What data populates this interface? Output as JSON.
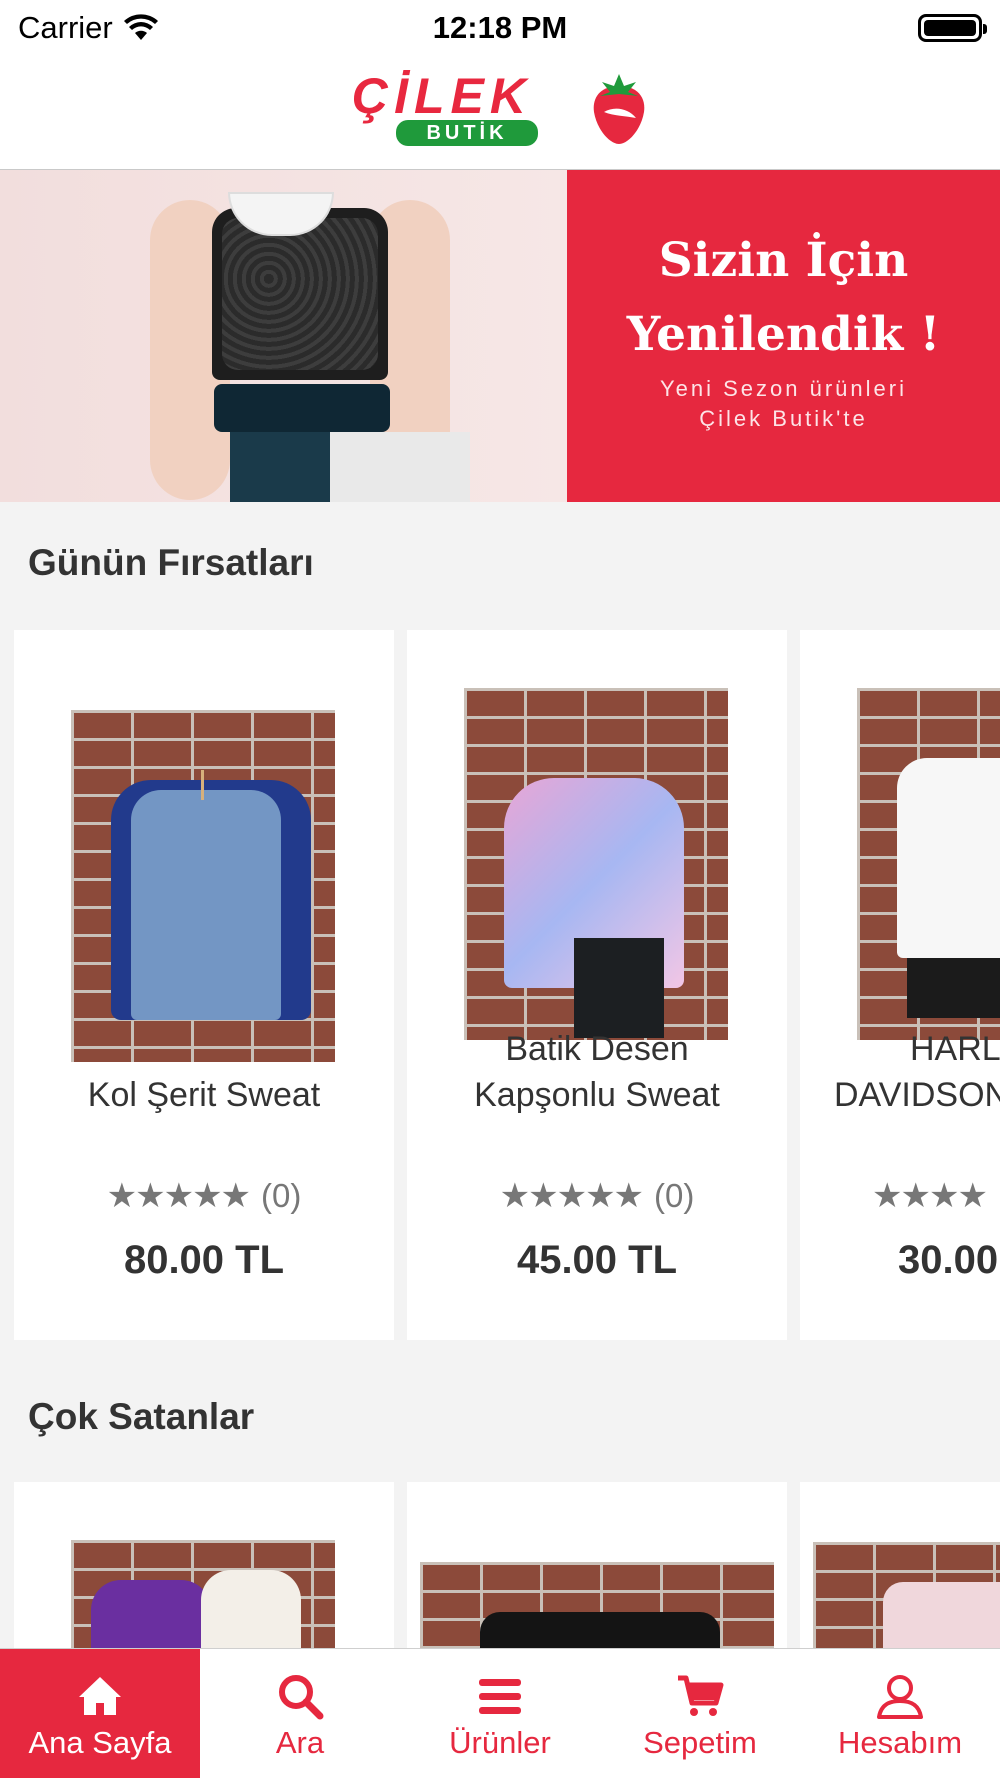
{
  "status_bar": {
    "carrier": "Carrier",
    "time": "12:18 PM"
  },
  "header": {
    "logo_text": "ÇİLEK",
    "logo_sub": "BUTİK"
  },
  "banner": {
    "headline_line1": "Sizin İçin",
    "headline_line2": "Yenilendik !",
    "sub_line1": "Yeni Sezon ürünleri",
    "sub_line2": "Çilek Butik'te"
  },
  "sections": {
    "deals_title": "Günün Fırsatları",
    "bestsellers_title": "Çok Satanlar"
  },
  "deals": [
    {
      "name_line1": "",
      "name_line2": "Kol Şerit Sweat",
      "stars": "★★★★★",
      "count": "(0)",
      "price": "80.00 TL"
    },
    {
      "name_line1": "Batik Desen",
      "name_line2": "Kapşonlu Sweat",
      "stars": "★★★★★",
      "count": "(0)",
      "price": "45.00 TL"
    },
    {
      "name_line1": "HARL",
      "name_line2": "DAVIDSON",
      "stars": "★★★★",
      "count": "",
      "price": "30.00"
    }
  ],
  "tabs": [
    {
      "label": "Ana Sayfa",
      "icon": "home-icon"
    },
    {
      "label": "Ara",
      "icon": "search-icon"
    },
    {
      "label": "Ürünler",
      "icon": "menu-icon"
    },
    {
      "label": "Sepetim",
      "icon": "cart-icon"
    },
    {
      "label": "Hesabım",
      "icon": "user-icon"
    }
  ],
  "colors": {
    "accent": "#e6283f",
    "logo_green": "#1f9a3b"
  }
}
